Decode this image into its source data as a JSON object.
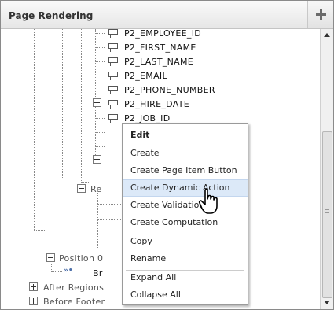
{
  "panel": {
    "title": "Page Rendering",
    "add_icon": "plus-icon"
  },
  "tree": {
    "items": [
      {
        "label": "P2_EMPLOYEE_ID"
      },
      {
        "label": "P2_FIRST_NAME"
      },
      {
        "label": "P2_LAST_NAME"
      },
      {
        "label": "P2_EMAIL"
      },
      {
        "label": "P2_PHONE_NUMBER"
      },
      {
        "label": "P2_HIRE_DATE"
      },
      {
        "label": "P2_JOB_ID"
      }
    ],
    "region_partial": "Re",
    "position_partial": "Position 0",
    "breadcrumb_partial": "Br",
    "after_regions": "After Regions",
    "before_footer": "Before Footer"
  },
  "context_menu": {
    "items": [
      {
        "label": "Edit"
      },
      {
        "label": "Create"
      },
      {
        "label": "Create Page Item Button"
      },
      {
        "label": "Create Dynamic Action"
      },
      {
        "label": "Create Validation"
      },
      {
        "label": "Create Computation"
      },
      {
        "label": "Copy"
      },
      {
        "label": "Rename"
      },
      {
        "label": "Expand All"
      },
      {
        "label": "Collapse All"
      }
    ]
  },
  "colors": {
    "menu_highlight": "#dce9f8",
    "link_blue": "#4b6ea8"
  }
}
